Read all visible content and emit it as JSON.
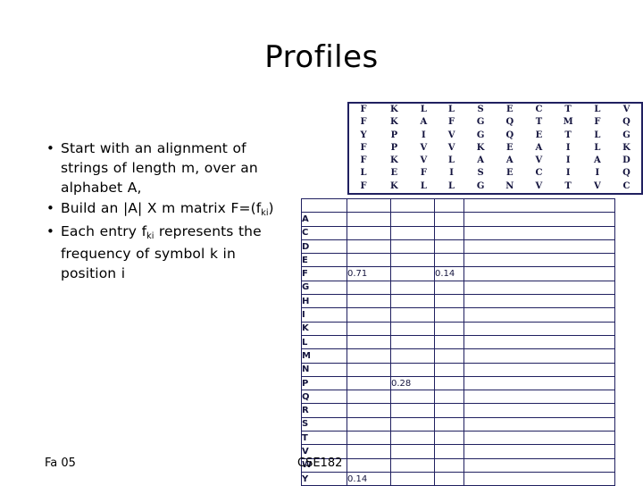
{
  "slide": {
    "title": "Profiles"
  },
  "bullets": [
    {
      "marker": "•",
      "parts": [
        {
          "t": "Start with an alignment of strings of length m, over an alphabet A,"
        }
      ]
    },
    {
      "marker": "•",
      "parts": [
        {
          "t": "Build an |A| X m matrix F=(f"
        },
        {
          "t": "ki",
          "sub": true
        },
        {
          "t": ")"
        }
      ]
    },
    {
      "marker": "•",
      "parts": [
        {
          "t": "Each entry f"
        },
        {
          "t": "ki",
          "sub": true
        },
        {
          "t": " represents the frequency of symbol k in position i"
        }
      ]
    }
  ],
  "alignment": {
    "columns": [
      {
        "width": "cw36",
        "letters": [
          "F",
          "F",
          "Y",
          "F",
          "F",
          "L",
          "F"
        ]
      },
      {
        "width": "cw40",
        "letters": [
          "K",
          "K",
          "P",
          "P",
          "K",
          "E",
          "K"
        ]
      },
      {
        "width": "cw33",
        "letters": [
          "L",
          "A",
          "I",
          "V",
          "V",
          "F",
          "L"
        ]
      },
      {
        "width": "cw36",
        "letters": [
          "L",
          "F",
          "V",
          "V",
          "L",
          "I",
          "L"
        ]
      },
      {
        "width": "cw36",
        "letters": [
          "S",
          "G",
          "G",
          "K",
          "A",
          "S",
          "G"
        ]
      },
      {
        "width": "cw36",
        "letters": [
          "E",
          "Q",
          "Q",
          "E",
          "A",
          "E",
          "N"
        ]
      },
      {
        "width": "cw36",
        "letters": [
          "C",
          "T",
          "E",
          "A",
          "V",
          "C",
          "V"
        ]
      },
      {
        "width": "cw36",
        "letters": [
          "T",
          "M",
          "T",
          "I",
          "I",
          "I",
          "T"
        ]
      },
      {
        "width": "cw36",
        "letters": [
          "L",
          "F",
          "L",
          "L",
          "A",
          "I",
          "V"
        ]
      },
      {
        "width": "cw36",
        "letters": [
          "V",
          "Q",
          "G",
          "K",
          "D",
          "Q",
          "C"
        ]
      }
    ]
  },
  "profile": {
    "rows": [
      {
        "label": "A",
        "cells": [
          "",
          "",
          "",
          ""
        ]
      },
      {
        "label": "C",
        "cells": [
          "",
          "",
          "",
          ""
        ]
      },
      {
        "label": "D",
        "cells": [
          "",
          "",
          "",
          ""
        ]
      },
      {
        "label": "E",
        "cells": [
          "",
          "",
          "",
          ""
        ]
      },
      {
        "label": "F",
        "cells": [
          "0.71",
          "",
          "0.14",
          ""
        ],
        "ruled": true
      },
      {
        "label": "G",
        "cells": [
          "",
          "",
          "",
          ""
        ]
      },
      {
        "label": "H",
        "cells": [
          "",
          "",
          "",
          ""
        ]
      },
      {
        "label": "I",
        "cells": [
          "",
          "",
          "",
          ""
        ]
      },
      {
        "label": "K",
        "cells": [
          "",
          "",
          "",
          ""
        ]
      },
      {
        "label": "L",
        "cells": [
          "",
          "",
          "",
          ""
        ]
      },
      {
        "label": "M",
        "cells": [
          "",
          "",
          "",
          ""
        ]
      },
      {
        "label": "N",
        "cells": [
          "",
          "",
          "",
          ""
        ]
      },
      {
        "label": "P",
        "cells": [
          "",
          "0.28",
          "",
          ""
        ],
        "ruled": true
      },
      {
        "label": "Q",
        "cells": [
          "",
          "",
          "",
          ""
        ]
      },
      {
        "label": "R",
        "cells": [
          "",
          "",
          "",
          ""
        ]
      },
      {
        "label": "S",
        "cells": [
          "",
          "",
          "",
          ""
        ]
      },
      {
        "label": "T",
        "cells": [
          "",
          "",
          "",
          ""
        ]
      },
      {
        "label": "V",
        "cells": [
          "",
          "",
          "",
          ""
        ]
      },
      {
        "label": "W",
        "cells": [
          "",
          "",
          "",
          ""
        ]
      },
      {
        "label": "Y",
        "cells": [
          "0.14",
          "",
          "",
          ""
        ],
        "ruled": true
      }
    ]
  },
  "footer": {
    "left": "Fa 05",
    "center": "CSE182"
  },
  "colors": {
    "grid": "#202060",
    "text": "#000000",
    "matrix_text": "#15153f",
    "background": "#ffffff"
  }
}
